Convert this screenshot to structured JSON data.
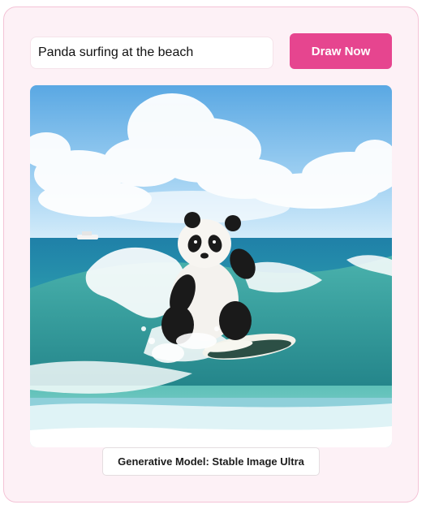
{
  "prompt": {
    "value": "Panda surfing at the beach"
  },
  "draw_button": {
    "label": "Draw Now"
  },
  "image": {
    "description_name": "generated-image",
    "accent": "#e6458f"
  },
  "model_badge": {
    "text": "Generative Model: Stable Image Ultra"
  }
}
